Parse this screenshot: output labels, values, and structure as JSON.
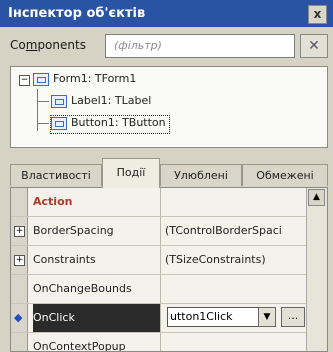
{
  "window": {
    "title": "Інспектор об'єктів",
    "close_glyph": "x"
  },
  "components": {
    "label_prefix": "Co",
    "label_underlined": "m",
    "label_rest": "ponents",
    "filter_placeholder": "(фільтр)",
    "filter_button_icon": "filter-clear-icon"
  },
  "tree": {
    "expander": "⊟",
    "nodes": [
      {
        "label": "Form1: TForm1"
      },
      {
        "label": "Label1: TLabel"
      },
      {
        "label": "Button1: TButton",
        "selected": true
      }
    ]
  },
  "tabs": [
    {
      "label": "Властивості"
    },
    {
      "label": "Події",
      "active": true
    },
    {
      "label": "Улюблені"
    },
    {
      "label": "Обмежені"
    }
  ],
  "grid": {
    "rows": [
      {
        "name": "Action",
        "value": "",
        "name_color": "#b8382a"
      },
      {
        "name": "BorderSpacing",
        "value": "(TControlBorderSpaci",
        "expandable": true
      },
      {
        "name": "Constraints",
        "value": "(TSizeConstraints)",
        "expandable": true
      },
      {
        "name": "OnChangeBounds",
        "value": ""
      },
      {
        "name": "OnClick",
        "value": "utton1Click",
        "selected": true
      },
      {
        "name": "OnContextPopup",
        "value": ""
      }
    ],
    "ellipsis": "...",
    "combo_arrow": "▼",
    "scroll_up": "▲",
    "current_marker": "◆",
    "plus": "+"
  }
}
